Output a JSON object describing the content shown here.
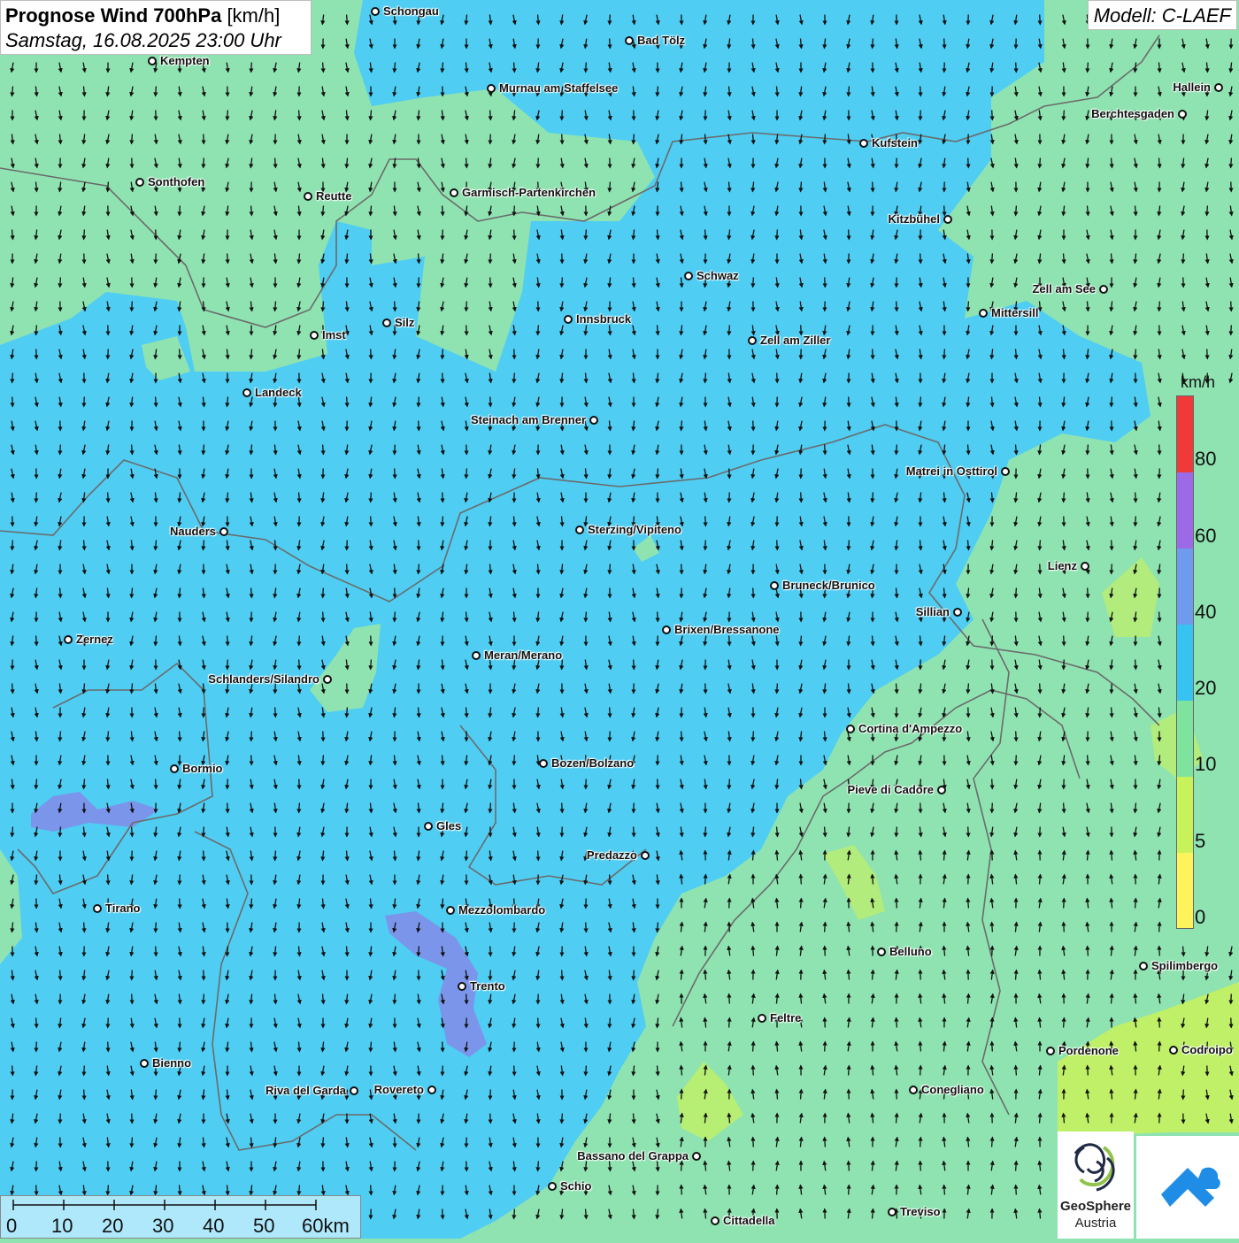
{
  "header": {
    "title": "Prognose Wind 700hPa",
    "unit": "[km/h]",
    "datetime": "Samstag, 16.08.2025 23:00 Uhr"
  },
  "model_label": "Modell: C-LAEF",
  "legend": {
    "unit": "km/h",
    "labels": [
      "80",
      "60",
      "40",
      "20",
      "10",
      "5",
      "0"
    ],
    "bands": [
      {
        "from": 80,
        "color": "#f03a3a"
      },
      {
        "from": 60,
        "color": "#9c6ae6"
      },
      {
        "from": 40,
        "color": "#6f9bef"
      },
      {
        "from": 20,
        "color": "#36c3f2"
      },
      {
        "from": 10,
        "color": "#7ee39c"
      },
      {
        "from": 5,
        "color": "#c8f25a"
      },
      {
        "from": 0,
        "color": "#fff35c"
      }
    ]
  },
  "scale_bar": {
    "labels": [
      "0",
      "10",
      "20",
      "30",
      "40",
      "50",
      "60km"
    ]
  },
  "cities": [
    {
      "name": "Schongau"
    },
    {
      "name": "Bad Tölz"
    },
    {
      "name": "Kempten"
    },
    {
      "name": "Murnau am Staffelsee"
    },
    {
      "name": "Hallein"
    },
    {
      "name": "Berchtesgaden"
    },
    {
      "name": "Kufstein"
    },
    {
      "name": "Sonthofen"
    },
    {
      "name": "Reutte"
    },
    {
      "name": "Garmisch-Partenkirchen"
    },
    {
      "name": "Kitzbühel"
    },
    {
      "name": "Schwaz"
    },
    {
      "name": "Zell am See"
    },
    {
      "name": "Mittersill"
    },
    {
      "name": "Innsbruck"
    },
    {
      "name": "Silz"
    },
    {
      "name": "Imst"
    },
    {
      "name": "Zell am Ziller"
    },
    {
      "name": "Landeck"
    },
    {
      "name": "Steinach am Brenner"
    },
    {
      "name": "Matrei in Osttirol"
    },
    {
      "name": "Nauders"
    },
    {
      "name": "Sterzing/Vipiteno"
    },
    {
      "name": "Lienz"
    },
    {
      "name": "Bruneck/Brunico"
    },
    {
      "name": "Sillian"
    },
    {
      "name": "Brixen/Bressanone"
    },
    {
      "name": "Zernez"
    },
    {
      "name": "Meran/Merano"
    },
    {
      "name": "Schlanders/Silandro"
    },
    {
      "name": "Cortina d'Ampezzo"
    },
    {
      "name": "Bozen/Bolzano"
    },
    {
      "name": "Bormio"
    },
    {
      "name": "Pieve di Cadore"
    },
    {
      "name": "Gles"
    },
    {
      "name": "Predazzo"
    },
    {
      "name": "Tirano"
    },
    {
      "name": "Mezzolombardo"
    },
    {
      "name": "Belluno"
    },
    {
      "name": "Spilimbergo"
    },
    {
      "name": "Trento"
    },
    {
      "name": "Feltre"
    },
    {
      "name": "Pordenone"
    },
    {
      "name": "Codroipo"
    },
    {
      "name": "Bienno"
    },
    {
      "name": "Riva del Garda"
    },
    {
      "name": "Rovereto"
    },
    {
      "name": "Conegliano"
    },
    {
      "name": "Bassano del Grappa"
    },
    {
      "name": "Schio"
    },
    {
      "name": "Treviso"
    },
    {
      "name": "Cittadella"
    }
  ],
  "logos": {
    "geosphere_name": "GeoSphere",
    "geosphere_sub": "Austria"
  },
  "wind_arrow_direction": "southward",
  "colors": {
    "band_0_5": "#fff35c",
    "band_5_10": "#c8f25a",
    "band_10_20": "#8fe3b1",
    "band_20_40": "#4fcdf3",
    "band_40_60": "#7b95ea",
    "border_gray": "#6b6b6b",
    "brand_blue": "#1f8de6"
  }
}
